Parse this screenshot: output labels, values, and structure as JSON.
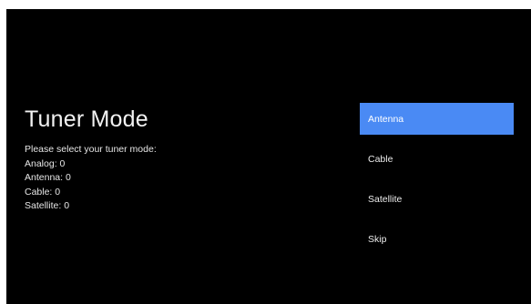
{
  "page": {
    "title": "Tuner Mode",
    "prompt": "Please select your tuner mode:",
    "stats": [
      "Analog: 0",
      "Antenna: 0",
      "Cable: 0",
      "Satellite: 0"
    ]
  },
  "menu": {
    "selected_index": 0,
    "items": [
      {
        "label": "Antenna"
      },
      {
        "label": "Cable"
      },
      {
        "label": "Satellite"
      },
      {
        "label": "Skip"
      }
    ]
  },
  "colors": {
    "background": "#000000",
    "accent": "#4a8af4",
    "text": "#f2f2f2"
  }
}
